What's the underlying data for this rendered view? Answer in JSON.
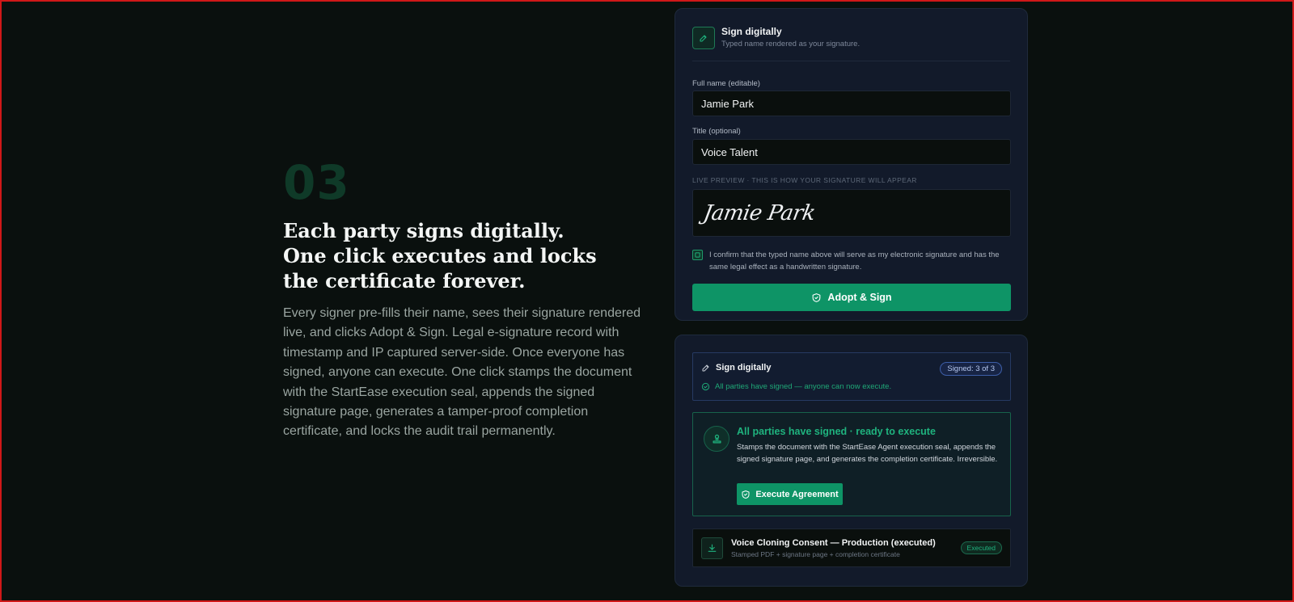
{
  "step": {
    "number": "03",
    "headline": "Each party signs digitally. One click executes and locks the certificate forever.",
    "body": "Every signer pre-fills their name, sees their signature rendered live, and clicks Adopt & Sign. Legal e-signature record with timestamp and IP captured server-side. Once everyone has signed, anyone can execute. One click stamps the document with the StartEase execution seal, appends the signed signature page, generates a tamper-proof completion certificate, and locks the audit trail permanently."
  },
  "sign_card": {
    "title": "Sign digitally",
    "subtitle": "Typed name rendered as your signature.",
    "full_name_label": "Full name (editable)",
    "full_name_value": "Jamie Park",
    "title_label": "Title (optional)",
    "title_value": "Voice Talent",
    "preview_label": "LIVE PREVIEW · THIS IS HOW YOUR SIGNATURE WILL APPEAR",
    "signature_preview": "Jamie Park",
    "consent_text": "I confirm that the typed name above will serve as my electronic signature and has the same legal effect as a handwritten signature.",
    "consent_checked": true,
    "adopt_button": "Adopt & Sign"
  },
  "execute_card": {
    "status_title": "Sign digitally",
    "status_badge": "Signed: 3 of 3",
    "status_sub": "All parties have signed — anyone can now execute.",
    "ready_title": "All parties have signed · ready to execute",
    "ready_desc": "Stamps the document with the StartEase Agent execution seal, appends the signed signature page, and generates the completion certificate. Irreversible.",
    "execute_button": "Execute Agreement",
    "doc_title": "Voice Cloning Consent — Production (executed)",
    "doc_sub": "Stamped PDF + signature page + completion certificate",
    "doc_badge": "Executed"
  },
  "colors": {
    "background": "#0a100e",
    "card": "#121a2a",
    "accent_green": "#0e9466",
    "step_number": "#0f3a28",
    "signed_badge_border": "#3d5ea8"
  },
  "icons": {
    "sign_header": "pen-icon",
    "consent": "checkbox-checked-icon",
    "adopt": "shield-check-icon",
    "status": "pen-icon",
    "status_ok": "check-circle-icon",
    "ready": "stamp-icon",
    "execute": "shield-check-icon",
    "doc": "download-icon"
  }
}
